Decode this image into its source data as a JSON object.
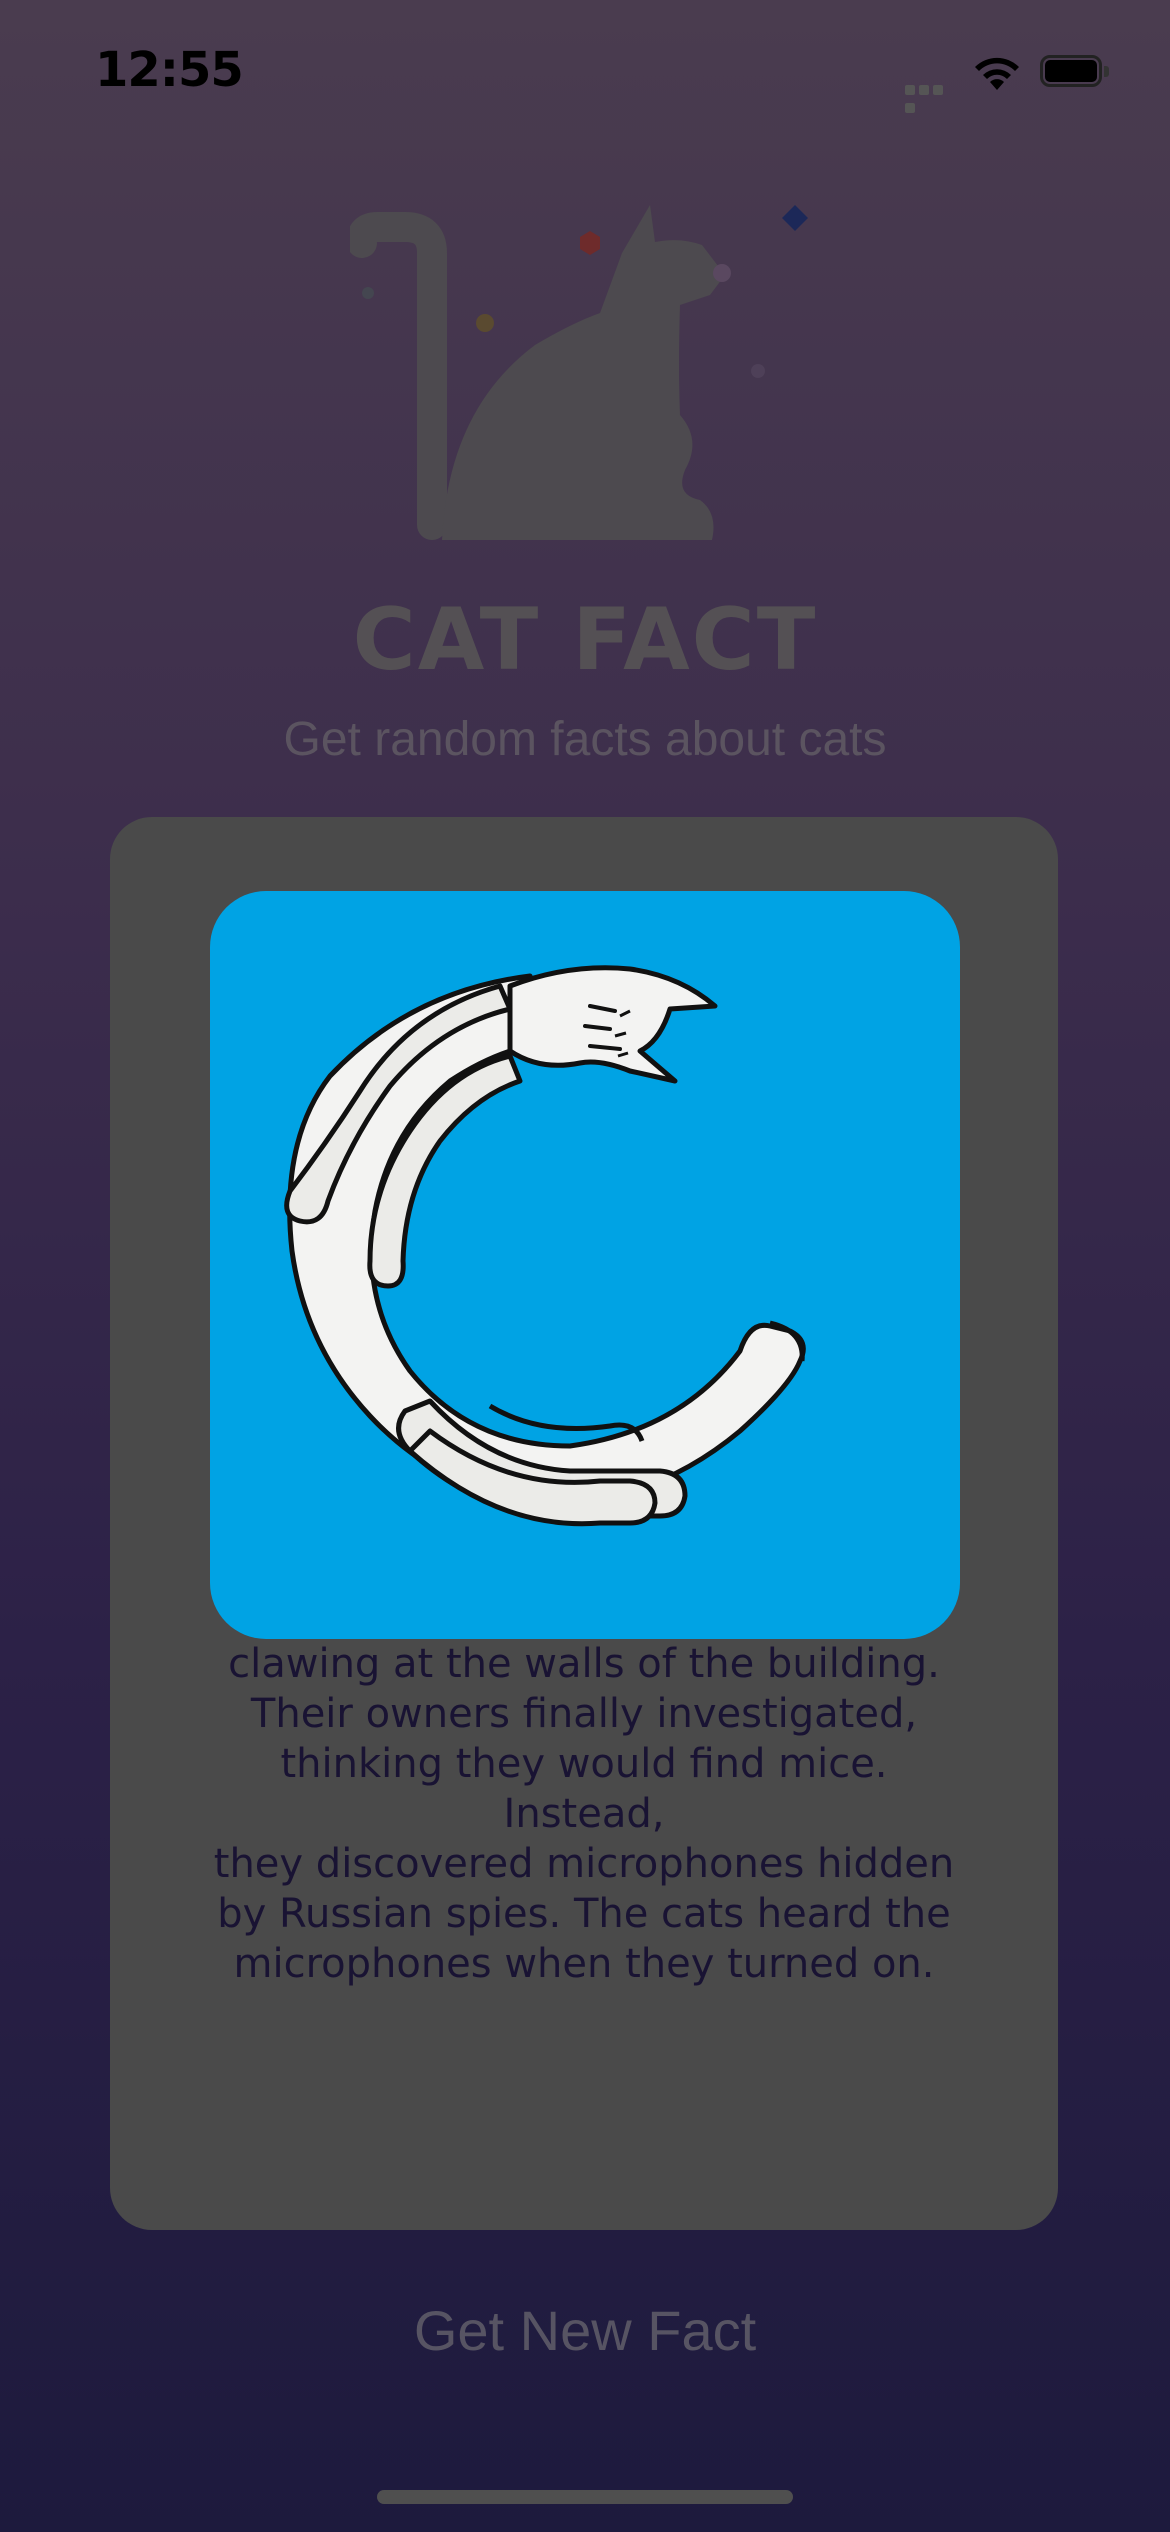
{
  "status_bar": {
    "time": "12:55",
    "icons": [
      "cellular-signal-icon",
      "wifi-icon",
      "battery-icon"
    ]
  },
  "header": {
    "illustration_icon": "cat-silhouette-icon",
    "title": "CAT FACT",
    "subtitle": "Get random facts about cats"
  },
  "fact_card": {
    "image_icon": "curled-cat-icon",
    "text": "clawing at the walls of the building.\nTheir owners finally investigated,\nthinking they would find mice. Instead,\nthey discovered microphones hidden\nby Russian spies. The cats heard the\nmicrophones when they turned on."
  },
  "actions": {
    "new_fact_label": "Get New Fact"
  },
  "colors": {
    "background_top": "#4a3c4f",
    "background_bottom": "#1d1a3d",
    "card": "#4a4a4a",
    "image_background": "#00a3e4",
    "cat_fill": "#f3f3f2"
  }
}
